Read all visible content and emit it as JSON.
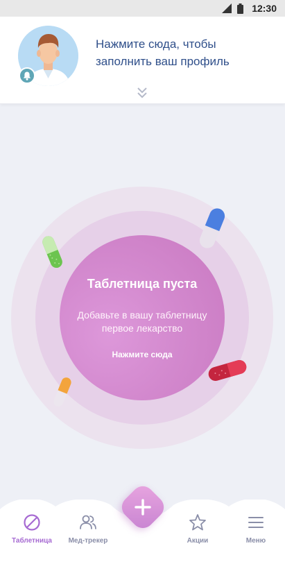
{
  "status_bar": {
    "time": "12:30",
    "icons": [
      "signal-icon",
      "battery-icon"
    ]
  },
  "header": {
    "prompt": "Нажмите сюда, чтобы заполнить ваш профиль",
    "avatar": "doctor-avatar",
    "badge_icon": "bell-icon",
    "expand_icon": "double-chevron-down-icon"
  },
  "pillbox": {
    "title": "Таблетница пуста",
    "description": "Добавьте в вашу таблетницу первое лекарство",
    "cta": "Нажмите сюда"
  },
  "colors": {
    "accent": "#c979c1",
    "prompt_text": "#2f4f8a",
    "nav_active": "#a66ad2",
    "nav_inactive": "#8a8ea8"
  },
  "bottom_nav": {
    "items": [
      {
        "label": "Таблетница",
        "icon": "pill-slash-icon",
        "active": true
      },
      {
        "label": "Мед-трекер",
        "icon": "people-icon",
        "active": false
      },
      {
        "label": "Акции",
        "icon": "star-icon",
        "active": false
      },
      {
        "label": "Меню",
        "icon": "menu-icon",
        "active": false
      }
    ],
    "add_icon": "plus-icon"
  }
}
